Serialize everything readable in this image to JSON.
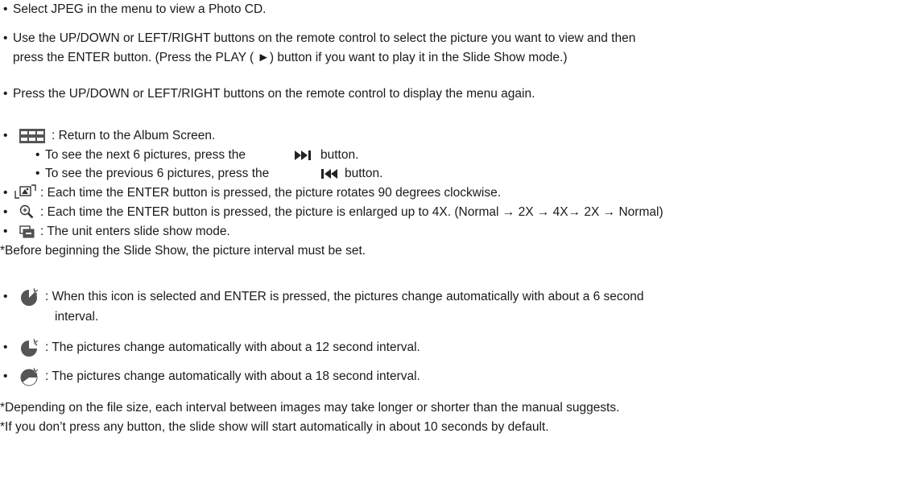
{
  "lines": {
    "l1": "Select JPEG in the menu to view a Photo CD.",
    "l2a": "Use the UP/DOWN or LEFT/RIGHT buttons on the remote control to select the picture you want to view and then",
    "l2b": "press the ENTER button. (Press the PLAY ( ►) button if you want to play it in the Slide Show mode.)",
    "l3": "Press the UP/DOWN or LEFT/RIGHT buttons on the remote control to display the menu again.",
    "album": ": Return to the Album Screen.",
    "next_a": "To see the next 6 pictures, press the",
    "next_b": "button.",
    "prev_a": "To see the previous 6 pictures, press the",
    "prev_b": "button.",
    "rotate": ": Each time the ENTER button is pressed, the picture rotates 90 degrees clockwise.",
    "zoom": ": Each time the ENTER button is pressed, the picture is enlarged up to 4X. (Normal → 2X → 4X→ 2X → Normal)",
    "slide": ": The unit enters slide show mode.",
    "note1": "*Before beginning the Slide Show, the picture interval must be set.",
    "i6a": ": When this icon is selected and ENTER is pressed, the pictures change automatically with about a 6 second",
    "i6b": "interval.",
    "i12": ": The pictures change automatically with about a 12 second interval.",
    "i18": ": The pictures change automatically with about a 18 second interval.",
    "note2": "*Depending on the file size, each interval between images may take longer or shorter than the manual suggests.",
    "note3": "*If you don’t press any button, the slide show will start automatically in about 10 seconds by default."
  },
  "bullet": "•",
  "icons": [
    "album-grid-icon",
    "skip-next-icon",
    "skip-previous-icon",
    "rotate-icon",
    "zoom-icon",
    "slideshow-icon",
    "timer-6s-icon",
    "timer-12s-icon",
    "timer-18s-icon"
  ]
}
